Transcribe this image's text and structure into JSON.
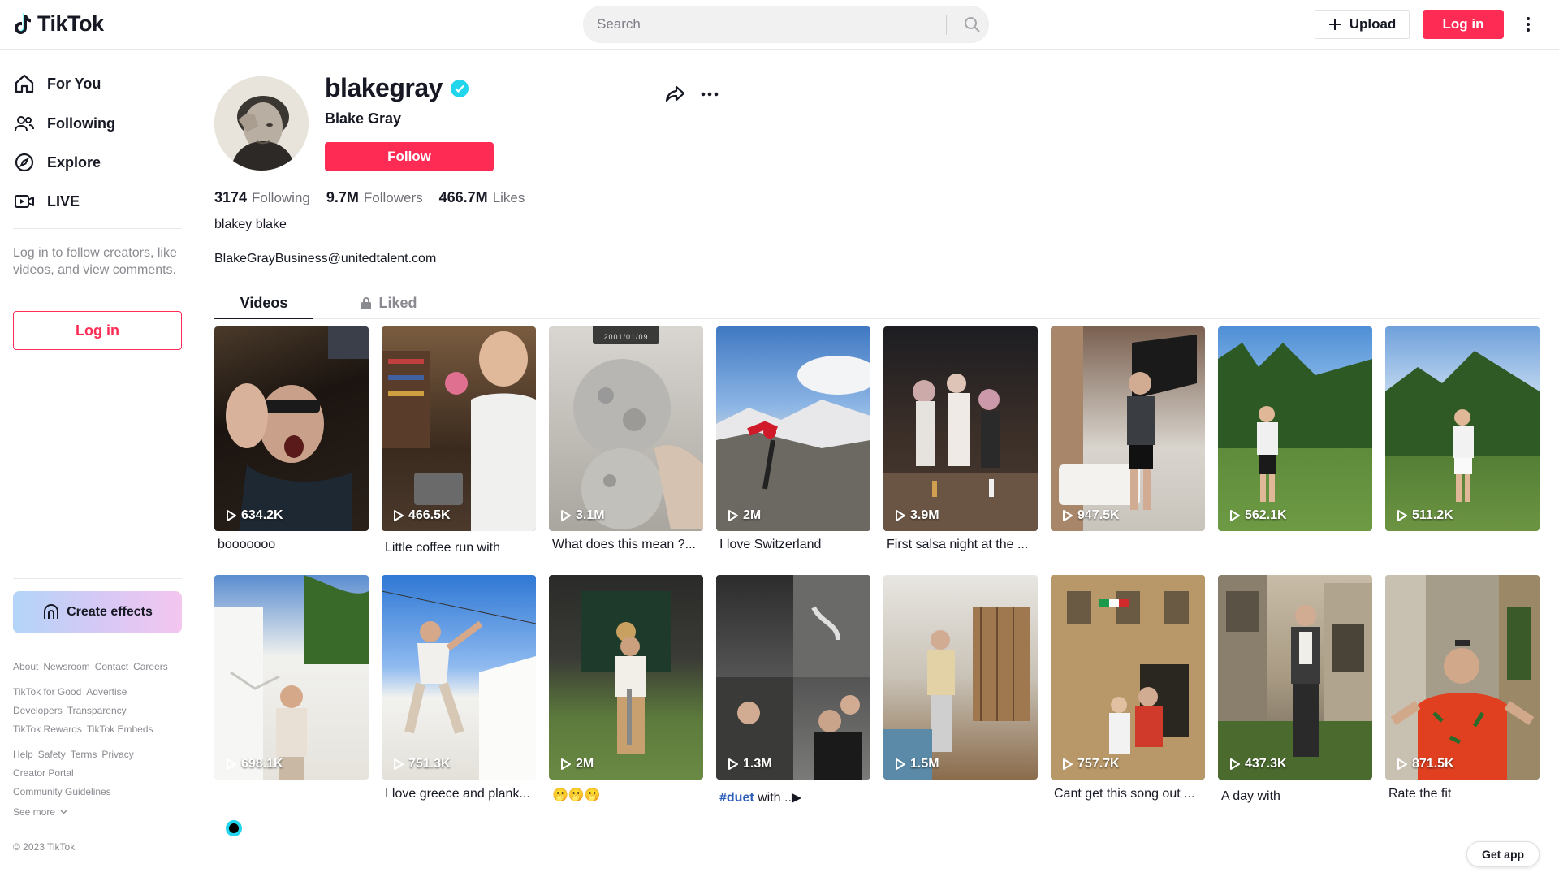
{
  "header": {
    "logo": "TikTok",
    "search_placeholder": "Search",
    "upload_label": "Upload",
    "login_label": "Log in"
  },
  "sidebar": {
    "nav": [
      {
        "label": "For You",
        "icon": "home-icon"
      },
      {
        "label": "Following",
        "icon": "users-icon"
      },
      {
        "label": "Explore",
        "icon": "compass-icon"
      },
      {
        "label": "LIVE",
        "icon": "live-icon"
      }
    ],
    "login_message": "Log in to follow creators, like videos, and view comments.",
    "login_button": "Log in",
    "create_effects": "Create effects",
    "links_row1": [
      "About",
      "Newsroom",
      "Contact",
      "Careers"
    ],
    "links_row2": [
      "TikTok for Good",
      "Advertise"
    ],
    "links_row3": [
      "Developers",
      "Transparency"
    ],
    "links_row4": [
      "TikTok Rewards",
      "TikTok Embeds"
    ],
    "links_row5": [
      "Help",
      "Safety",
      "Terms",
      "Privacy"
    ],
    "links_row6": [
      "Creator Portal"
    ],
    "links_row7": [
      "Community Guidelines"
    ],
    "see_more": "See more",
    "copyright": "© 2023 TikTok"
  },
  "profile": {
    "username": "blakegray",
    "nickname": "Blake Gray",
    "follow_label": "Follow",
    "following_count": "3174",
    "following_label": "Following",
    "followers_count": "9.7M",
    "followers_label": "Followers",
    "likes_count": "466.7M",
    "likes_label": "Likes",
    "bio": "blakey blake",
    "email": "BlakeGrayBusiness@unitedtalent.com"
  },
  "tabs": {
    "videos": "Videos",
    "liked": "Liked"
  },
  "videos": [
    {
      "views": "634.2K",
      "caption": "booooooo"
    },
    {
      "views": "466.5K",
      "caption": "Little coffee run with"
    },
    {
      "views": "3.1M",
      "caption": "What does this mean ?...",
      "date_tag": "2001/01/09"
    },
    {
      "views": "2M",
      "caption": "I love Switzerland"
    },
    {
      "views": "3.9M",
      "caption": "First salsa night at the ..."
    },
    {
      "views": "947.5K",
      "caption": ""
    },
    {
      "views": "562.1K",
      "caption": ""
    },
    {
      "views": "511.2K",
      "caption": ""
    },
    {
      "views": "698.1K",
      "caption": ""
    },
    {
      "views": "751.3K",
      "caption": "I love greece and plank..."
    },
    {
      "views": "2M",
      "caption": "🫢🫢🫢"
    },
    {
      "views": "1.3M",
      "caption_tag": "#duet",
      "caption": " with ..▶"
    },
    {
      "views": "1.5M",
      "caption": ""
    },
    {
      "views": "757.7K",
      "caption": "Cant get this song out ..."
    },
    {
      "views": "437.3K",
      "caption": "A day with"
    },
    {
      "views": "871.5K",
      "caption": "Rate the fit"
    }
  ],
  "get_app": "Get app"
}
